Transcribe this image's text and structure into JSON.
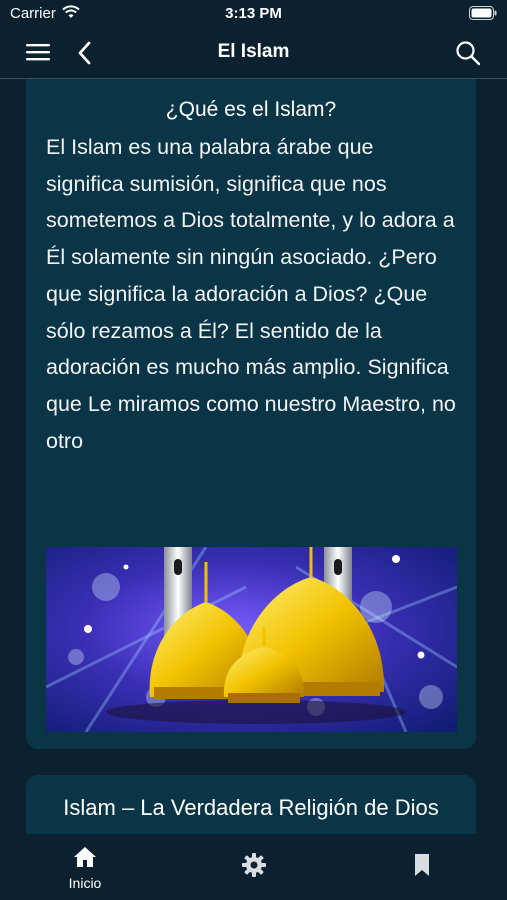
{
  "status_bar": {
    "carrier": "Carrier",
    "time": "3:13 PM",
    "icons": [
      "wifi-icon",
      "battery-icon"
    ]
  },
  "nav": {
    "title": "El Islam",
    "icons": [
      "menu-icon",
      "back-icon",
      "search-icon"
    ]
  },
  "articles": [
    {
      "title": "¿Qué es el Islam?",
      "body": "El Islam es una palabra árabe que significa sumisión, significa que nos sometemos a Dios totalmente, y lo adora a Él solamente sin ningún asociado. ¿Pero que significa la adoración a Dios? ¿Que sólo rezamos a Él? El sentido de la adoración es mucho más amplio. Significa que Le miramos como nuestro Maestro, no otro",
      "image": "golden-domes-mosque"
    },
    {
      "title": "Islam – La Verdadera Religión de Dios"
    }
  ],
  "tab_bar": {
    "tabs": [
      {
        "label": "Inicio",
        "icon": "home-icon",
        "active": true
      },
      {
        "label": "",
        "icon": "settings-icon",
        "active": false
      },
      {
        "label": "",
        "icon": "bookmark-icon",
        "active": false
      }
    ]
  },
  "colors": {
    "background": "#0b2130",
    "card": "#0a3547",
    "text": "#ffffff",
    "divider": "#3a4f5c"
  }
}
